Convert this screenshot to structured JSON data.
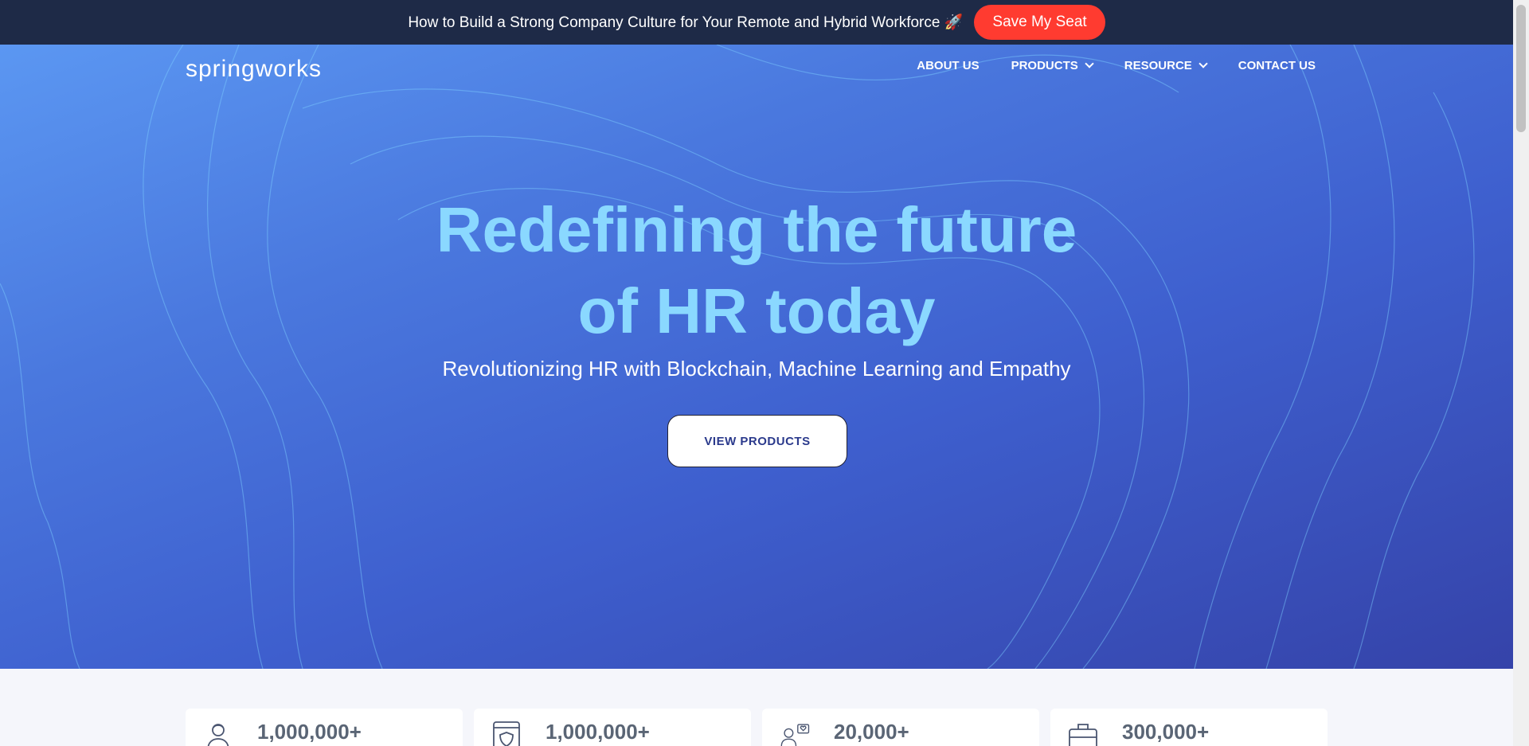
{
  "announcement": {
    "text": "How to Build a Strong Company Culture for Your Remote and Hybrid Workforce 🚀",
    "button_label": "Save My Seat"
  },
  "header": {
    "logo_text": "springworks",
    "nav": [
      {
        "label": "ABOUT US"
      },
      {
        "label": "PRODUCTS"
      },
      {
        "label": "RESOURCE"
      },
      {
        "label": "CONTACT US"
      }
    ]
  },
  "hero": {
    "title_line1": "Redefining the future",
    "title_line2": "of HR today",
    "subtitle": "Revolutionizing HR with Blockchain, Machine Learning and Empathy",
    "cta_label": "VIEW PRODUCTS"
  },
  "stats": [
    {
      "icon": "person-icon",
      "value": "1,000,000+"
    },
    {
      "icon": "shield-document-icon",
      "value": "1,000,000+"
    },
    {
      "icon": "person-heart-icon",
      "value": "20,000+"
    },
    {
      "icon": "briefcase-icon",
      "value": "300,000+"
    }
  ],
  "colors": {
    "topbar": "#1e2a47",
    "accent_button": "#ff3b30",
    "headline": "#8ad8ff"
  }
}
